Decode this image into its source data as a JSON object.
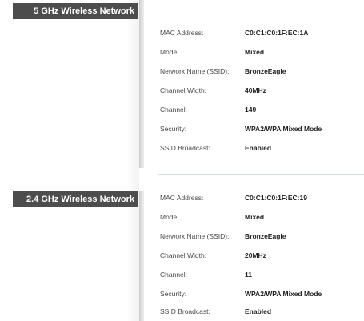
{
  "sections": [
    {
      "title": "5 GHz Wireless Network",
      "rows": [
        {
          "label": "MAC Address:",
          "value": "C0:C1:C0:1F:EC:1A"
        },
        {
          "label": "Mode:",
          "value": "Mixed"
        },
        {
          "label": "Network Name (SSID):",
          "value": "BronzeEagle"
        },
        {
          "label": "Channel Width:",
          "value": "40MHz"
        },
        {
          "label": "Channel:",
          "value": "149"
        },
        {
          "label": "Security:",
          "value": "WPA2/WPA Mixed Mode"
        },
        {
          "label": "SSID Broadcast:",
          "value": "Enabled"
        }
      ]
    },
    {
      "title": "2.4 GHz Wireless Network",
      "rows": [
        {
          "label": "MAC Address:",
          "value": "C0:C1:C0:1F:EC:19"
        },
        {
          "label": "Mode:",
          "value": "Mixed"
        },
        {
          "label": "Network Name (SSID):",
          "value": "BronzeEagle"
        },
        {
          "label": "Channel Width:",
          "value": "20MHz"
        },
        {
          "label": "Channel:",
          "value": "11"
        },
        {
          "label": "Security:",
          "value": "WPA2/WPA Mixed Mode"
        },
        {
          "label": "SSID Broadcast:",
          "value": "Enabled"
        }
      ]
    }
  ],
  "colors": {
    "header_bg": "#4d4d4d",
    "header_text": "#ffffff",
    "divider": "#d8deea"
  }
}
